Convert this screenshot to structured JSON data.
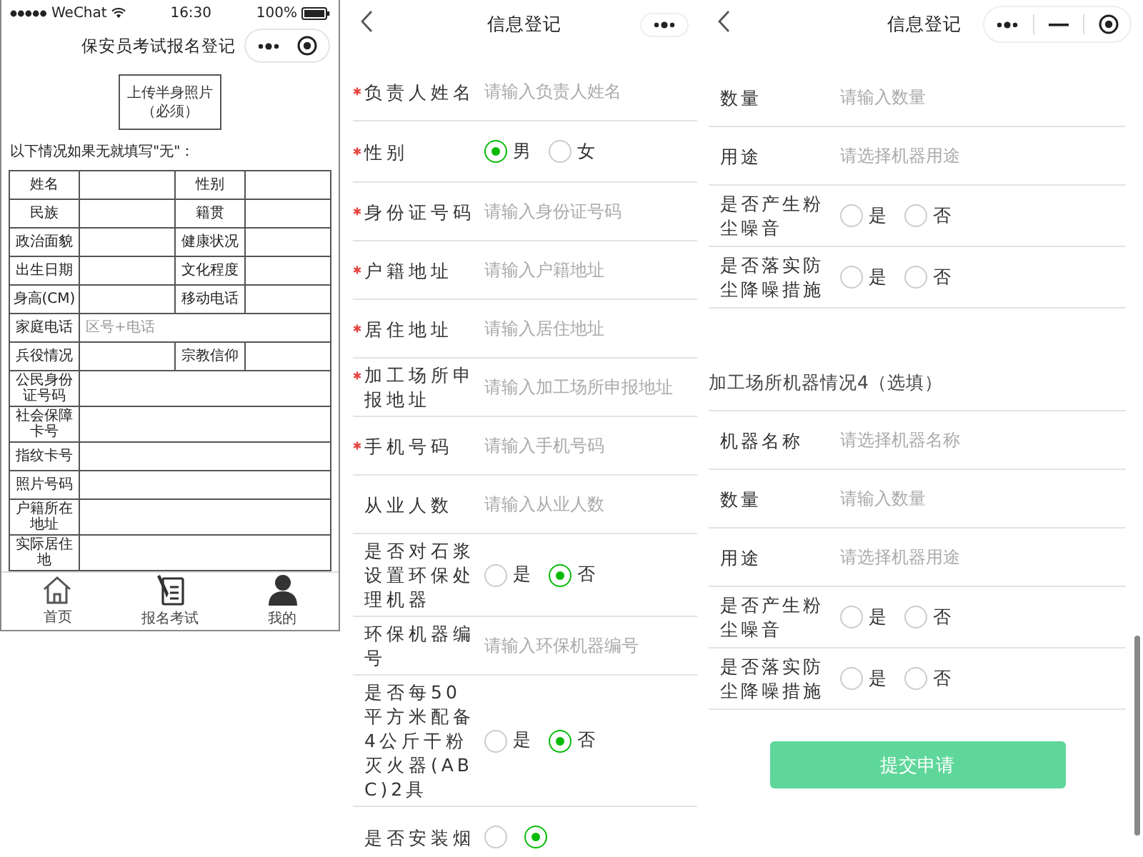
{
  "left_screen": {
    "status_bar": {
      "carrier": "WeChat",
      "time": "16:30",
      "battery": "100%"
    },
    "title": "保安员考试报名登记",
    "photo_upload": {
      "label": "上传半身照片",
      "note": "（必须）"
    },
    "instruction": "以下情况如果无就填写\"无\"：",
    "table": {
      "rows": [
        {
          "kind": "pair",
          "labels": [
            "姓名",
            "性别"
          ]
        },
        {
          "kind": "pair",
          "labels": [
            "民族",
            "籍贯"
          ]
        },
        {
          "kind": "pair",
          "labels": [
            "政治面貌",
            "健康状况"
          ]
        },
        {
          "kind": "pair",
          "labels": [
            "出生日期",
            "文化程度"
          ]
        },
        {
          "kind": "pair",
          "labels": [
            "身高(CM)",
            "移动电话"
          ]
        },
        {
          "kind": "wide",
          "labels": [
            "家庭电话"
          ],
          "placeholder": "区号+电话"
        },
        {
          "kind": "pair",
          "labels": [
            "兵役情况",
            "宗教信仰"
          ]
        },
        {
          "kind": "wide",
          "labels": [
            "公民身份证号码"
          ]
        },
        {
          "kind": "wide",
          "labels": [
            "社会保障卡号"
          ]
        },
        {
          "kind": "wide",
          "labels": [
            "指纹卡号"
          ]
        },
        {
          "kind": "wide",
          "labels": [
            "照片号码"
          ]
        },
        {
          "kind": "wide",
          "labels": [
            "户籍所在地址"
          ]
        },
        {
          "kind": "wide",
          "labels": [
            "实际居住地"
          ]
        }
      ]
    },
    "tab_bar": [
      {
        "label": "首页"
      },
      {
        "label": "报名考试"
      },
      {
        "label": "我的"
      }
    ]
  },
  "middle_screen": {
    "title": "信息登记",
    "rows": [
      {
        "kind": "input",
        "label": "负责人姓名",
        "required": true,
        "placeholder": "请输入负责人姓名"
      },
      {
        "kind": "radio",
        "label": "性别",
        "required": true,
        "options": [
          {
            "label": "男",
            "selected": true
          },
          {
            "label": "女",
            "selected": false
          }
        ]
      },
      {
        "kind": "input",
        "label": "身份证号码",
        "required": true,
        "placeholder": "请输入身份证号码"
      },
      {
        "kind": "input",
        "label": "户籍地址",
        "required": true,
        "placeholder": "请输入户籍地址"
      },
      {
        "kind": "input",
        "label": "居住地址",
        "required": true,
        "placeholder": "请输入居住地址"
      },
      {
        "kind": "input",
        "label": "加工场所申报地址",
        "required": true,
        "placeholder": "请输入加工场所申报地址"
      },
      {
        "kind": "input",
        "label": "手机号码",
        "required": true,
        "placeholder": "请输入手机号码"
      },
      {
        "kind": "input",
        "label": "从业人数",
        "required": false,
        "placeholder": "请输入从业人数"
      },
      {
        "kind": "radio",
        "label": "是否对石浆设置环保处理机器",
        "required": false,
        "options": [
          {
            "label": "是",
            "selected": false
          },
          {
            "label": "否",
            "selected": true
          }
        ]
      },
      {
        "kind": "input",
        "label": "环保机器编号",
        "required": false,
        "placeholder": "请输入环保机器编号"
      },
      {
        "kind": "radio",
        "label": "是否每50平方米配备4公斤干粉灭火器(ABC)2具",
        "required": false,
        "options": [
          {
            "label": "是",
            "selected": false
          },
          {
            "label": "否",
            "selected": true
          }
        ]
      },
      {
        "kind": "radio",
        "label": "是否安装烟",
        "required": false,
        "options": [
          {
            "selected": false
          },
          {
            "selected": true
          }
        ]
      }
    ]
  },
  "right_screen": {
    "title": "信息登记",
    "rows": [
      {
        "kind": "input",
        "label": "数量",
        "required": false,
        "placeholder": "请输入数量"
      },
      {
        "kind": "input",
        "label": "用途",
        "required": false,
        "placeholder": "请选择机器用途"
      },
      {
        "kind": "radio",
        "label": "是否产生粉尘噪音",
        "required": false,
        "options": [
          {
            "label": "是",
            "selected": false
          },
          {
            "label": "否",
            "selected": false
          }
        ]
      },
      {
        "kind": "radio",
        "label": "是否落实防尘降噪措施",
        "required": false,
        "options": [
          {
            "label": "是",
            "selected": false
          },
          {
            "label": "否",
            "selected": false
          }
        ]
      },
      {
        "kind": "section",
        "label": "加工场所机器情况4（选填）"
      },
      {
        "kind": "input",
        "label": "机器名称",
        "required": false,
        "placeholder": "请选择机器名称"
      },
      {
        "kind": "input",
        "label": "数量",
        "required": false,
        "placeholder": "请输入数量"
      },
      {
        "kind": "input",
        "label": "用途",
        "required": false,
        "placeholder": "请选择机器用途"
      },
      {
        "kind": "radio",
        "label": "是否产生粉尘噪音",
        "required": false,
        "options": [
          {
            "label": "是",
            "selected": false
          },
          {
            "label": "否",
            "selected": false
          }
        ]
      },
      {
        "kind": "radio",
        "label": "是否落实防尘降噪措施",
        "required": false,
        "options": [
          {
            "label": "是",
            "selected": false
          },
          {
            "label": "否",
            "selected": false
          }
        ]
      }
    ],
    "submit_button": "提交申请"
  }
}
